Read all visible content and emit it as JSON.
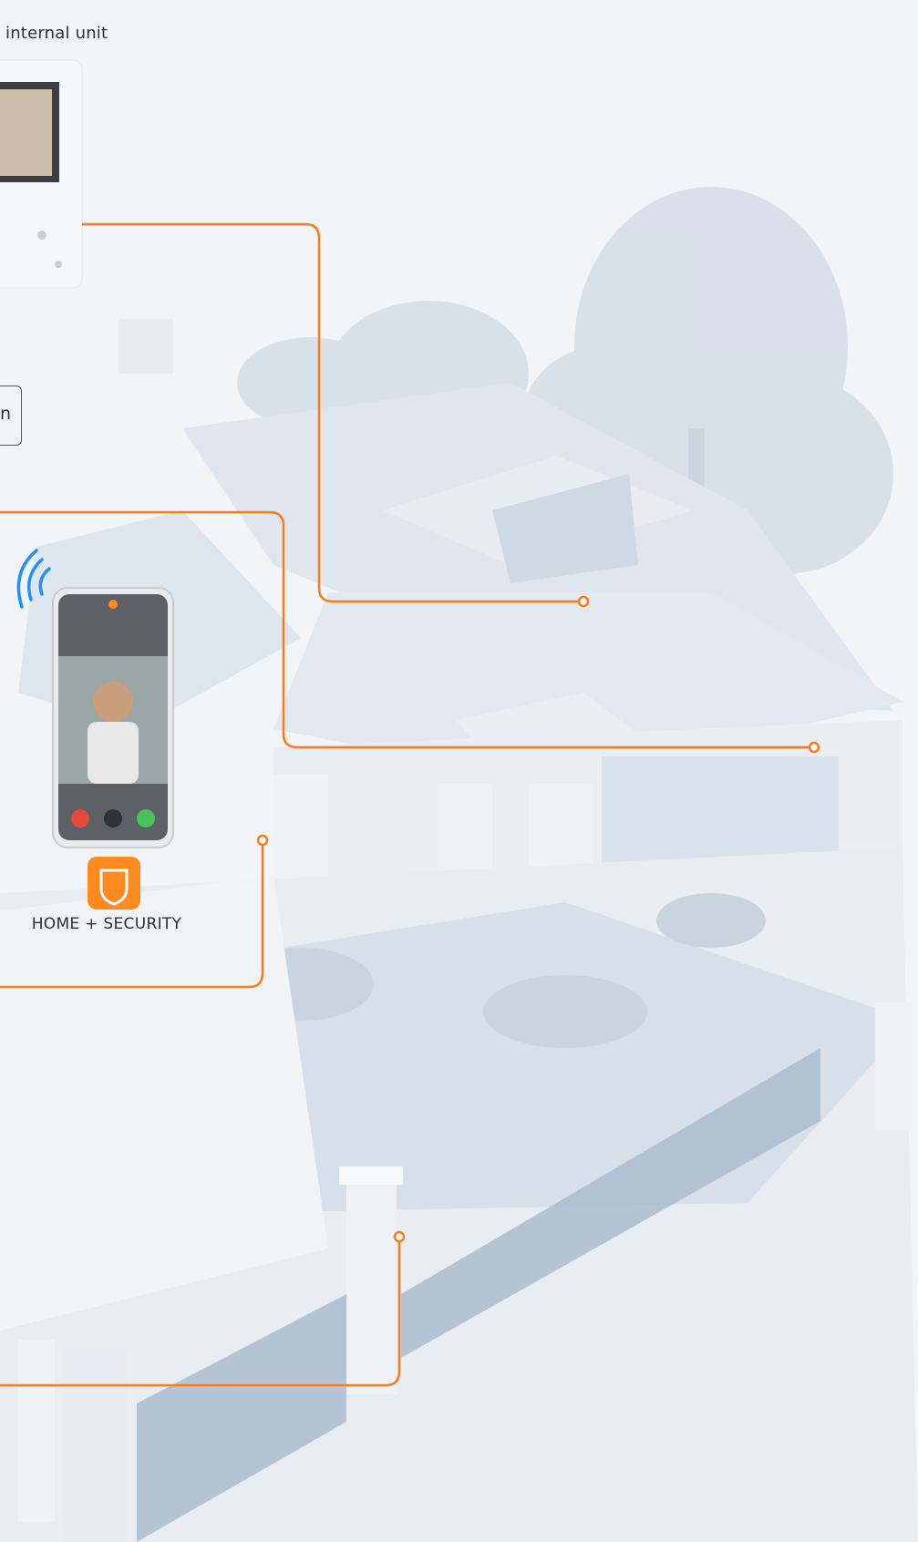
{
  "labels": {
    "internal_unit": "internal unit",
    "partial_box_text": "n",
    "app_name": "HOME + SECURITY"
  },
  "colors": {
    "connector": "#ff7a1a",
    "app_icon": "#ff8a1f",
    "wifi": "#1e90ff",
    "background": "#eef2f6",
    "house": "#dfe7ef"
  },
  "icons": {
    "app": "shield-icon",
    "wireless": "wifi-signal-icon",
    "decline": "phone-hangup-icon",
    "unlock": "key-icon",
    "accept": "phone-answer-icon"
  }
}
